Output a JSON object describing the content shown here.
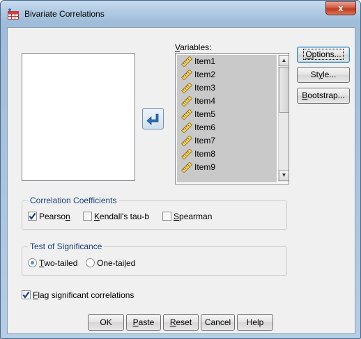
{
  "window": {
    "title": "Bivariate Correlations",
    "close_glyph": "x"
  },
  "variables": {
    "label_mnemonic": "V",
    "label_rest": "ariables:",
    "items": [
      "Item1",
      "Item2",
      "Item3",
      "Item4",
      "Item5",
      "Item6",
      "Item7",
      "Item8",
      "Item9"
    ]
  },
  "side_buttons": {
    "options": {
      "mn": "O",
      "rest": "ptions..."
    },
    "style": {
      "pre": "St",
      "mn": "y",
      "rest": "le..."
    },
    "bootstrap": {
      "mn": "B",
      "rest": "ootstrap..."
    }
  },
  "coefficients": {
    "title": "Correlation Coefficients",
    "pearson": {
      "pre": "Pearso",
      "mn": "n",
      "rest": "",
      "checked": true
    },
    "kendall": {
      "pre": "",
      "mn": "K",
      "rest": "endall's tau-b",
      "checked": false
    },
    "spearman": {
      "pre": "",
      "mn": "S",
      "rest": "pearman",
      "checked": false
    }
  },
  "significance": {
    "title": "Test of Significance",
    "two_tailed": {
      "pre": "",
      "mn": "T",
      "rest": "wo-tailed",
      "selected": true
    },
    "one_tailed": {
      "pre": "One-tai",
      "mn": "l",
      "rest": "ed",
      "selected": false
    }
  },
  "flag": {
    "pre": "",
    "mn": "F",
    "rest": "lag significant correlations",
    "checked": true
  },
  "buttons": {
    "ok": {
      "pre": "OK",
      "mn": "",
      "rest": ""
    },
    "paste": {
      "pre": "",
      "mn": "P",
      "rest": "aste"
    },
    "reset": {
      "pre": "",
      "mn": "R",
      "rest": "eset"
    },
    "cancel": {
      "pre": "Cancel",
      "mn": "",
      "rest": ""
    },
    "help": {
      "pre": "Help",
      "mn": "",
      "rest": ""
    }
  },
  "colors": {
    "title_bar": "#9fbcd8",
    "close_button": "#c0391f",
    "selection_gray": "#c9c9c9",
    "group_title": "#1a3f7a",
    "check_mark": "#1a3f7a"
  },
  "icons": {
    "app": "spss-table-icon",
    "variable": "scale-ruler-icon",
    "move": "move-arrow-icon"
  }
}
